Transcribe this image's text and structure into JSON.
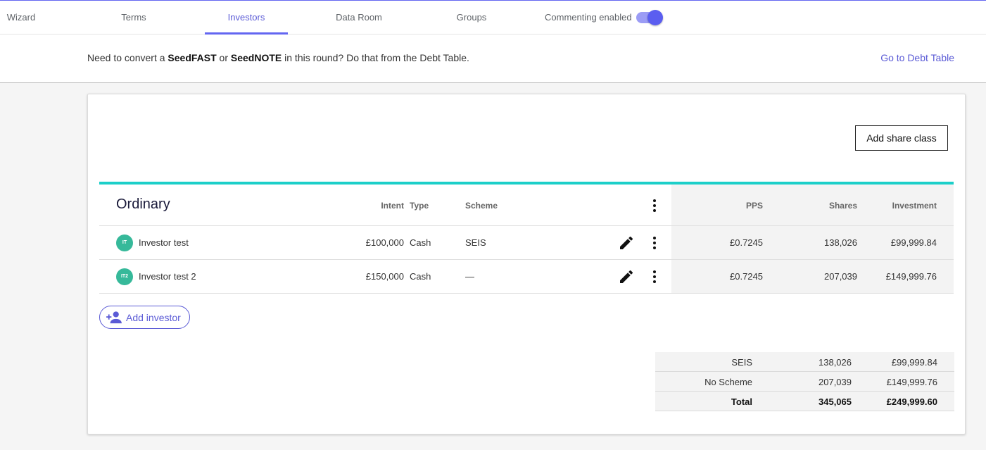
{
  "tabs": [
    {
      "label": "Wizard"
    },
    {
      "label": "Terms"
    },
    {
      "label": "Investors"
    },
    {
      "label": "Data Room"
    },
    {
      "label": "Groups"
    }
  ],
  "commenting": {
    "label": "Commenting enabled",
    "enabled": true
  },
  "banner": {
    "text_1": "Need to convert a ",
    "bold_1": "SeedFAST",
    "text_2": " or ",
    "bold_2": "SeedNOTE",
    "text_3": " in this round? Do that from the Debt Table.",
    "link": "Go to Debt Table"
  },
  "card": {
    "add_share_class": "Add share class",
    "share_class": {
      "name": "Ordinary",
      "columns": {
        "intent": "Intent",
        "type": "Type",
        "scheme": "Scheme",
        "pps": "PPS",
        "shares": "Shares",
        "investment": "Investment"
      },
      "rows": [
        {
          "initials": "IT",
          "name": "Investor test",
          "intent": "£100,000",
          "type": "Cash",
          "scheme": "SEIS",
          "pps": "£0.7245",
          "shares": "138,026",
          "investment": "£99,999.84"
        },
        {
          "initials": "IT2",
          "name": "Investor test 2",
          "intent": "£150,000",
          "type": "Cash",
          "scheme": "—",
          "pps": "£0.7245",
          "shares": "207,039",
          "investment": "£149,999.76"
        }
      ]
    },
    "add_investor": "Add investor",
    "summary": [
      {
        "label": "SEIS",
        "shares": "138,026",
        "investment": "£99,999.84"
      },
      {
        "label": "No Scheme",
        "shares": "207,039",
        "investment": "£149,999.76"
      },
      {
        "label": "Total",
        "shares": "345,065",
        "investment": "£249,999.60"
      }
    ]
  },
  "colors": {
    "accent": "#6366f1",
    "teal": "#1ccfc9",
    "avatar": "#36b99a"
  }
}
